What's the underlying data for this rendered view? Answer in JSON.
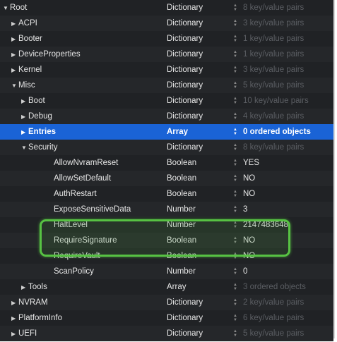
{
  "rows": [
    {
      "key": "Root",
      "type": "Dictionary",
      "value": "8 key/value pairs",
      "dim": true,
      "depth": 0,
      "disclosure": "expanded"
    },
    {
      "key": "ACPI",
      "type": "Dictionary",
      "value": "3 key/value pairs",
      "dim": true,
      "depth": 1,
      "disclosure": "collapsed"
    },
    {
      "key": "Booter",
      "type": "Dictionary",
      "value": "1 key/value pairs",
      "dim": true,
      "depth": 1,
      "disclosure": "collapsed"
    },
    {
      "key": "DeviceProperties",
      "type": "Dictionary",
      "value": "1 key/value pairs",
      "dim": true,
      "depth": 1,
      "disclosure": "collapsed"
    },
    {
      "key": "Kernel",
      "type": "Dictionary",
      "value": "3 key/value pairs",
      "dim": true,
      "depth": 1,
      "disclosure": "collapsed"
    },
    {
      "key": "Misc",
      "type": "Dictionary",
      "value": "5 key/value pairs",
      "dim": true,
      "depth": 1,
      "disclosure": "expanded"
    },
    {
      "key": "Boot",
      "type": "Dictionary",
      "value": "10 key/value pairs",
      "dim": true,
      "depth": 2,
      "disclosure": "collapsed"
    },
    {
      "key": "Debug",
      "type": "Dictionary",
      "value": "4 key/value pairs",
      "dim": true,
      "depth": 2,
      "disclosure": "collapsed"
    },
    {
      "key": "Entries",
      "type": "Array",
      "value": "0 ordered objects",
      "dim": false,
      "depth": 2,
      "disclosure": "collapsed",
      "selected": true
    },
    {
      "key": "Security",
      "type": "Dictionary",
      "value": "8 key/value pairs",
      "dim": true,
      "depth": 2,
      "disclosure": "expanded"
    },
    {
      "key": "AllowNvramReset",
      "type": "Boolean",
      "value": "YES",
      "dim": false,
      "depth": 3,
      "disclosure": "none"
    },
    {
      "key": "AllowSetDefault",
      "type": "Boolean",
      "value": "NO",
      "dim": false,
      "depth": 3,
      "disclosure": "none"
    },
    {
      "key": "AuthRestart",
      "type": "Boolean",
      "value": "NO",
      "dim": false,
      "depth": 3,
      "disclosure": "none"
    },
    {
      "key": "ExposeSensitiveData",
      "type": "Number",
      "value": "3",
      "dim": false,
      "depth": 3,
      "disclosure": "none"
    },
    {
      "key": "HaltLevel",
      "type": "Number",
      "value": "2147483648",
      "dim": false,
      "depth": 3,
      "disclosure": "none"
    },
    {
      "key": "RequireSignature",
      "type": "Boolean",
      "value": "NO",
      "dim": false,
      "depth": 3,
      "disclosure": "none"
    },
    {
      "key": "RequireVault",
      "type": "Boolean",
      "value": "NO",
      "dim": false,
      "depth": 3,
      "disclosure": "none"
    },
    {
      "key": "ScanPolicy",
      "type": "Number",
      "value": "0",
      "dim": false,
      "depth": 3,
      "disclosure": "none"
    },
    {
      "key": "Tools",
      "type": "Array",
      "value": "3 ordered objects",
      "dim": true,
      "depth": 2,
      "disclosure": "collapsed"
    },
    {
      "key": "NVRAM",
      "type": "Dictionary",
      "value": "2 key/value pairs",
      "dim": true,
      "depth": 1,
      "disclosure": "collapsed"
    },
    {
      "key": "PlatformInfo",
      "type": "Dictionary",
      "value": "6 key/value pairs",
      "dim": true,
      "depth": 1,
      "disclosure": "collapsed"
    },
    {
      "key": "UEFI",
      "type": "Dictionary",
      "value": "5 key/value pairs",
      "dim": true,
      "depth": 1,
      "disclosure": "collapsed"
    }
  ],
  "highlighted_rows": [
    "RequireSignature",
    "RequireVault"
  ],
  "colors": {
    "background": "#1d1f21",
    "selection": "#1a63d6",
    "highlight_border": "#57c243",
    "dim_text": "#5b5e63"
  },
  "icons": {
    "expanded": "disclosure-triangle-down-icon",
    "collapsed": "disclosure-triangle-right-icon",
    "stepper": "up-down-stepper-icon"
  }
}
